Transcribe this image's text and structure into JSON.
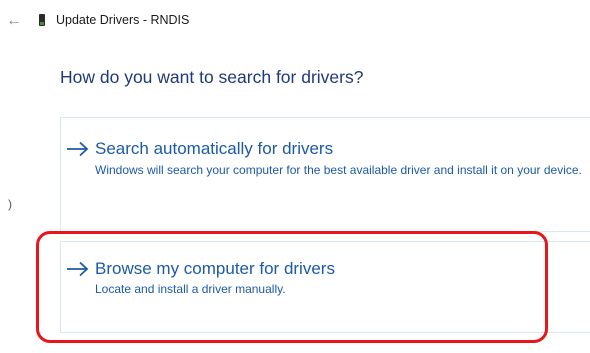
{
  "window": {
    "back_icon": "back-arrow-icon",
    "app_icon": "device-icon",
    "title": "Update Drivers - RNDIS"
  },
  "main": {
    "heading": "How do you want to search for drivers?",
    "options": [
      {
        "icon": "right-arrow-icon",
        "title": "Search automatically for drivers",
        "description": "Windows will search your computer for the best available driver and install it on your device."
      },
      {
        "icon": "right-arrow-icon",
        "title": "Browse my computer for drivers",
        "description": "Locate and install a driver manually."
      }
    ]
  },
  "side_mark": ")",
  "annotation": {
    "highlight_color": "#e8151b"
  },
  "colors": {
    "link_blue": "#1c5aa8",
    "heading_blue": "#1e3a78",
    "card_border": "#d9e8f2"
  }
}
